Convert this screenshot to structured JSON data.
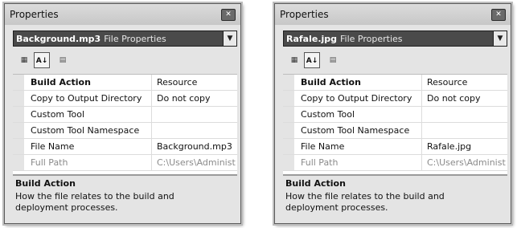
{
  "panels": [
    {
      "title": "Properties",
      "file_name": "Background.mp3",
      "file_type": "File Properties",
      "rows": [
        {
          "name": "Build Action",
          "value": "Resource"
        },
        {
          "name": "Copy to Output Directory",
          "value": "Do not copy"
        },
        {
          "name": "Custom Tool",
          "value": ""
        },
        {
          "name": "Custom Tool Namespace",
          "value": ""
        },
        {
          "name": "File Name",
          "value": "Background.mp3"
        },
        {
          "name": "Full Path",
          "value": "C:\\Users\\Administ"
        }
      ],
      "description": {
        "title": "Build Action",
        "text": "How the file relates to the build and deployment processes."
      }
    },
    {
      "title": "Properties",
      "file_name": "Rafale.jpg",
      "file_type": "File Properties",
      "rows": [
        {
          "name": "Build Action",
          "value": "Resource"
        },
        {
          "name": "Copy to Output Directory",
          "value": "Do not copy"
        },
        {
          "name": "Custom Tool",
          "value": ""
        },
        {
          "name": "Custom Tool Namespace",
          "value": ""
        },
        {
          "name": "File Name",
          "value": "Rafale.jpg"
        },
        {
          "name": "Full Path",
          "value": "C:\\Users\\Administ"
        }
      ],
      "description": {
        "title": "Build Action",
        "text": "How the file relates to the build and deployment processes."
      }
    }
  ],
  "icons": {
    "close": "close-icon",
    "dropdown": "chevron-down-icon",
    "categorized": "categorized-icon",
    "alphabetical": "sort-alphabetical-icon",
    "property_pages": "property-pages-icon"
  }
}
